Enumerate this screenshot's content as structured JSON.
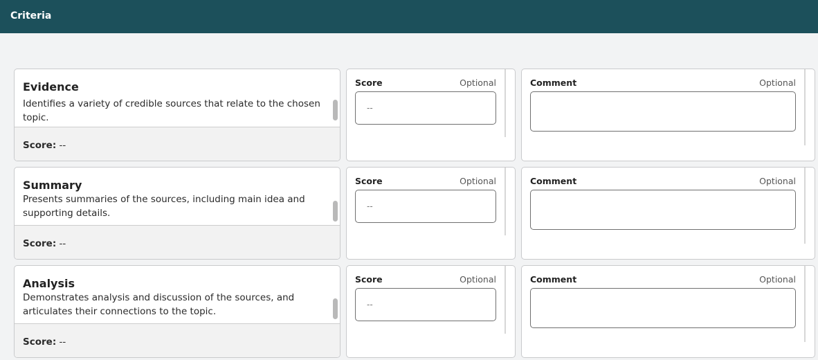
{
  "header": {
    "title": "Criteria"
  },
  "criteria": [
    {
      "title": "Evidence",
      "description": "Identifies a variety of credible sources that relate to the chosen topic.",
      "score_label": "Score:",
      "score_value": "--",
      "score_field": {
        "label": "Score",
        "optional": "Optional",
        "placeholder": "--"
      },
      "comment_field": {
        "label": "Comment",
        "optional": "Optional",
        "value": ""
      }
    },
    {
      "title": "Summary",
      "description": "Presents summaries of the sources, including main idea and supporting details.",
      "score_label": "Score:",
      "score_value": "--",
      "score_field": {
        "label": "Score",
        "optional": "Optional",
        "placeholder": "--"
      },
      "comment_field": {
        "label": "Comment",
        "optional": "Optional",
        "value": ""
      }
    },
    {
      "title": "Analysis",
      "description": "Demonstrates analysis and discussion of the sources, and articulates their connections to the topic.",
      "score_label": "Score:",
      "score_value": "--",
      "score_field": {
        "label": "Score",
        "optional": "Optional",
        "placeholder": "--"
      },
      "comment_field": {
        "label": "Comment",
        "optional": "Optional",
        "value": ""
      }
    }
  ],
  "colors": {
    "header_bg": "#1c505b",
    "page_bg": "#f2f3f4"
  }
}
